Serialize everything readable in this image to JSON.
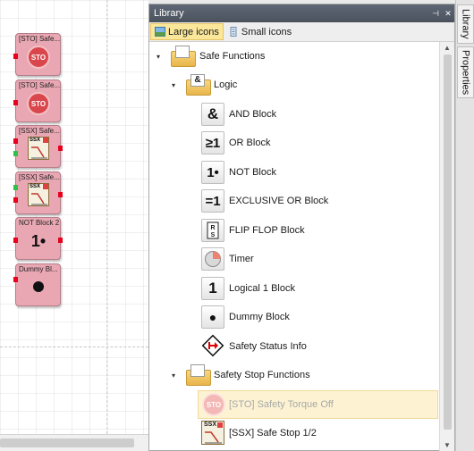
{
  "canvas": {
    "blocks": [
      {
        "title": "[STO] Safe...",
        "icon": "sto-icon",
        "icon_text": "STO"
      },
      {
        "title": "[STO] Safe...",
        "icon": "sto-icon",
        "icon_text": "STO"
      },
      {
        "title": "[SSX] Safe...",
        "icon": "ssx-icon",
        "icon_text": "SSX"
      },
      {
        "title": "[SSX] Safe...",
        "icon": "ssx-icon",
        "icon_text": "SSX"
      },
      {
        "title": "NOT Block 2",
        "icon": "not-icon",
        "icon_text": "1•"
      },
      {
        "title": "Dummy Bl...",
        "icon": "dummy-icon",
        "icon_text": ""
      }
    ]
  },
  "library": {
    "title": "Library",
    "titlebar_buttons": [
      "pin-icon",
      "close-icon"
    ],
    "tabs": [
      {
        "label": "Large icons",
        "active": true
      },
      {
        "label": "Small icons",
        "active": false
      }
    ],
    "tree": {
      "safe_functions": {
        "label": "Safe Functions",
        "expander": "▾"
      },
      "logic": {
        "label": "Logic",
        "expander": "▾",
        "folder_glyph": "&"
      },
      "items": [
        {
          "label": "AND Block",
          "glyph": "&"
        },
        {
          "label": "OR Block",
          "glyph": "≥1"
        },
        {
          "label": "NOT Block",
          "glyph": "1•"
        },
        {
          "label": "EXCLUSIVE OR Block",
          "glyph": "=1"
        },
        {
          "label": "FLIP FLOP Block",
          "glyph": "RS"
        },
        {
          "label": "Timer",
          "glyph": ""
        },
        {
          "label": "Logical 1 Block",
          "glyph": "1"
        },
        {
          "label": "Dummy Block",
          "glyph": "●"
        },
        {
          "label": "Safety Status Info",
          "glyph": ""
        }
      ],
      "safety_stop": {
        "label": "Safety Stop Functions",
        "expander": "▾"
      },
      "stop_items": [
        {
          "label": "[STO] Safety Torque Off",
          "glyph": "STO",
          "selected": true,
          "disabled": true
        },
        {
          "label": "[SSX] Safe Stop 1/2",
          "glyph": "SSX"
        }
      ]
    }
  },
  "side_tabs": [
    "Library",
    "Properties"
  ],
  "colors": {
    "block_fill": "#e8a7b3",
    "pin_red": "#e8001c",
    "pin_green": "#2fc04a",
    "tab_active": "#fbe79a",
    "titlebar": "#4f5762",
    "selected_row": "#fdf3d3"
  }
}
